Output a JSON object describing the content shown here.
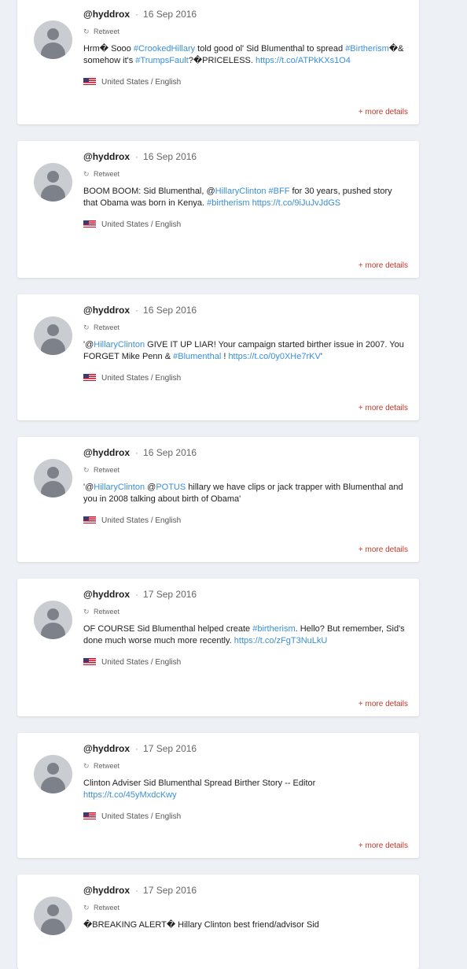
{
  "tweets": [
    {
      "handle": "@hyddrox",
      "sep": "·",
      "date": "16 Sep 2016",
      "retweet_label": "Retweet",
      "retweet_icon": "retweet-icon",
      "segments": [
        {
          "text": "Hrm� Sooo "
        },
        {
          "text": "#CrookedHillary",
          "link": true
        },
        {
          "text": " told good ol' Sid Blumenthal to spread "
        },
        {
          "text": "#Birtherism",
          "link": true
        },
        {
          "text": "�& somehow it's "
        },
        {
          "text": "#TrumpsFault",
          "link": true
        },
        {
          "text": "?�PRICELESS. "
        },
        {
          "text": "https://t.co/ATPkKXs1O4",
          "link": true
        }
      ],
      "locale": "United States / English",
      "more": "+ more details"
    },
    {
      "handle": "@hyddrox",
      "sep": "·",
      "date": "16 Sep 2016",
      "retweet_label": "Retweet",
      "retweet_icon": "retweet-icon",
      "segments": [
        {
          "text": "BOOM BOOM: Sid Blumenthal, @"
        },
        {
          "text": "HillaryClinton",
          "link": true
        },
        {
          "text": " "
        },
        {
          "text": "#BFF",
          "link": true
        },
        {
          "text": " for 30 years, pushed story that Obama was born in Kenya. "
        },
        {
          "text": "#birtherism",
          "link": true
        },
        {
          "text": " "
        },
        {
          "text": "https://t.co/9iJuJvJdGS",
          "link": true
        }
      ],
      "locale": "United States / English",
      "more": "+ more details"
    },
    {
      "handle": "@hyddrox",
      "sep": "·",
      "date": "16 Sep 2016",
      "retweet_label": "Retweet",
      "retweet_icon": "retweet-icon",
      "segments": [
        {
          "text": "'@"
        },
        {
          "text": "HillaryClinton",
          "link": true
        },
        {
          "text": " GIVE IT UP LIAR! Your campaign started birther issue in 2007. You FORGET Mike Penn & "
        },
        {
          "text": "#Blumenthal",
          "link": true
        },
        {
          "text": " ! "
        },
        {
          "text": "https://t.co/0y0XHe7rKV",
          "link": true
        },
        {
          "text": "'"
        }
      ],
      "locale": "United States / English",
      "more": "+ more details"
    },
    {
      "handle": "@hyddrox",
      "sep": "·",
      "date": "16 Sep 2016",
      "retweet_label": "Retweet",
      "retweet_icon": "retweet-icon",
      "segments": [
        {
          "text": "'@"
        },
        {
          "text": "HillaryClinton",
          "link": true
        },
        {
          "text": " @"
        },
        {
          "text": "POTUS",
          "link": true
        },
        {
          "text": " hillary we have clips or jack trapper with Blumenthal and you in 2008 talking about birth of Obama'"
        }
      ],
      "locale": "United States / English",
      "more": "+ more details"
    },
    {
      "handle": "@hyddrox",
      "sep": "·",
      "date": "17 Sep 2016",
      "retweet_label": "Retweet",
      "retweet_icon": "retweet-icon",
      "segments": [
        {
          "text": "OF COURSE Sid Blumenthal helped create "
        },
        {
          "text": "#birtherism",
          "link": true
        },
        {
          "text": ". Hello? But remember, Sid's done much worse much more recently. "
        },
        {
          "text": "https://t.co/zFgT3NuLkU",
          "link": true
        }
      ],
      "locale": "United States / English",
      "more": "+ more details"
    },
    {
      "handle": "@hyddrox",
      "sep": "·",
      "date": "17 Sep 2016",
      "retweet_label": "Retweet",
      "retweet_icon": "retweet-icon",
      "segments": [
        {
          "text": "Clinton Adviser Sid Blumenthal Spread Birther Story -- Editor "
        },
        {
          "text": "https://t.co/45yMxdcKwy",
          "link": true
        }
      ],
      "locale": "United States / English",
      "more": "+ more details"
    },
    {
      "handle": "@hyddrox",
      "sep": "·",
      "date": "17 Sep 2016",
      "retweet_label": "Retweet",
      "retweet_icon": "retweet-icon",
      "segments": [
        {
          "text": "�BREAKING ALERT� Hillary Clinton best friend/advisor Sid"
        }
      ],
      "locale": "",
      "more": ""
    }
  ],
  "colors": {
    "link": "#3a8fd6",
    "more": "#c0392b",
    "background": "#edf0f4"
  }
}
